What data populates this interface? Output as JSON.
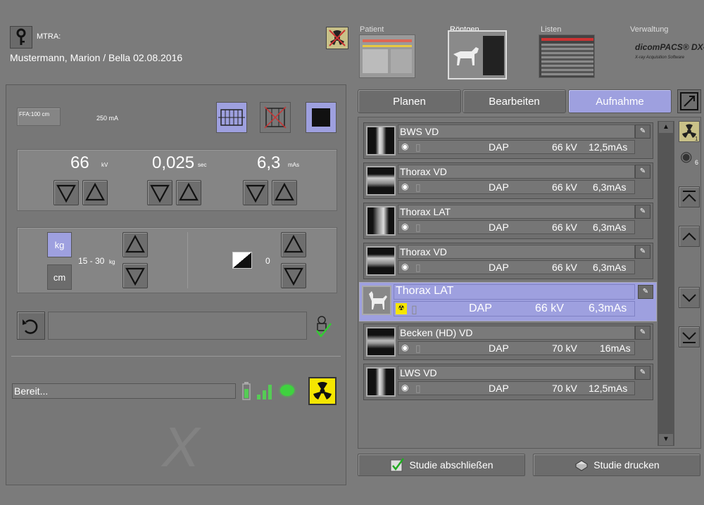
{
  "header": {
    "user_label": "MTRA:",
    "patient": "Mustermann, Marion / Bella  02.08.2016"
  },
  "nav": {
    "patient": "Patient",
    "xray": "Röntgen",
    "lists": "Listen",
    "admin": "Verwaltung",
    "brand": "dicomPACS® DX-R",
    "brand_sub": "X-ray Acquisition Software"
  },
  "generator": {
    "ffa": "FFA:100 cm",
    "ma": "250 mA",
    "kv_value": "66",
    "kv_unit": "kV",
    "sec_value": "0,025",
    "sec_unit": "sec",
    "mas_value": "6,3",
    "mas_unit": "mAs",
    "kg_button": "kg",
    "cm_button": "cm",
    "weight_range": "15 - 30",
    "weight_unit": "kg",
    "density_value": "0"
  },
  "status": {
    "text": "Bereit..."
  },
  "tabs": [
    "Planen",
    "Bearbeiten",
    "Aufnahme"
  ],
  "exposures": [
    {
      "name": "BWS VD",
      "dap": "DAP",
      "kv": "66 kV",
      "mas": "12,5mAs"
    },
    {
      "name": "Thorax VD",
      "dap": "DAP",
      "kv": "66 kV",
      "mas": "6,3mAs"
    },
    {
      "name": "Thorax LAT",
      "dap": "DAP",
      "kv": "66 kV",
      "mas": "6,3mAs"
    },
    {
      "name": "Thorax VD",
      "dap": "DAP",
      "kv": "66 kV",
      "mas": "6,3mAs"
    },
    {
      "name": "Thorax LAT",
      "dap": "DAP",
      "kv": "66 kV",
      "mas": "6,3mAs"
    },
    {
      "name": "Becken (HD) VD",
      "dap": "DAP",
      "kv": "70 kV",
      "mas": "16mAs"
    },
    {
      "name": "LWS VD",
      "dap": "DAP",
      "kv": "70 kV",
      "mas": "12,5mAs"
    }
  ],
  "side": {
    "rad_count": "1",
    "eye_count": "6"
  },
  "buttons": {
    "finish": "Studie abschließen",
    "print": "Studie drucken"
  },
  "colors": {
    "accent": "#9ea0df",
    "radiation_yellow": "#f5e600",
    "ready_green": "#3fd23f"
  }
}
